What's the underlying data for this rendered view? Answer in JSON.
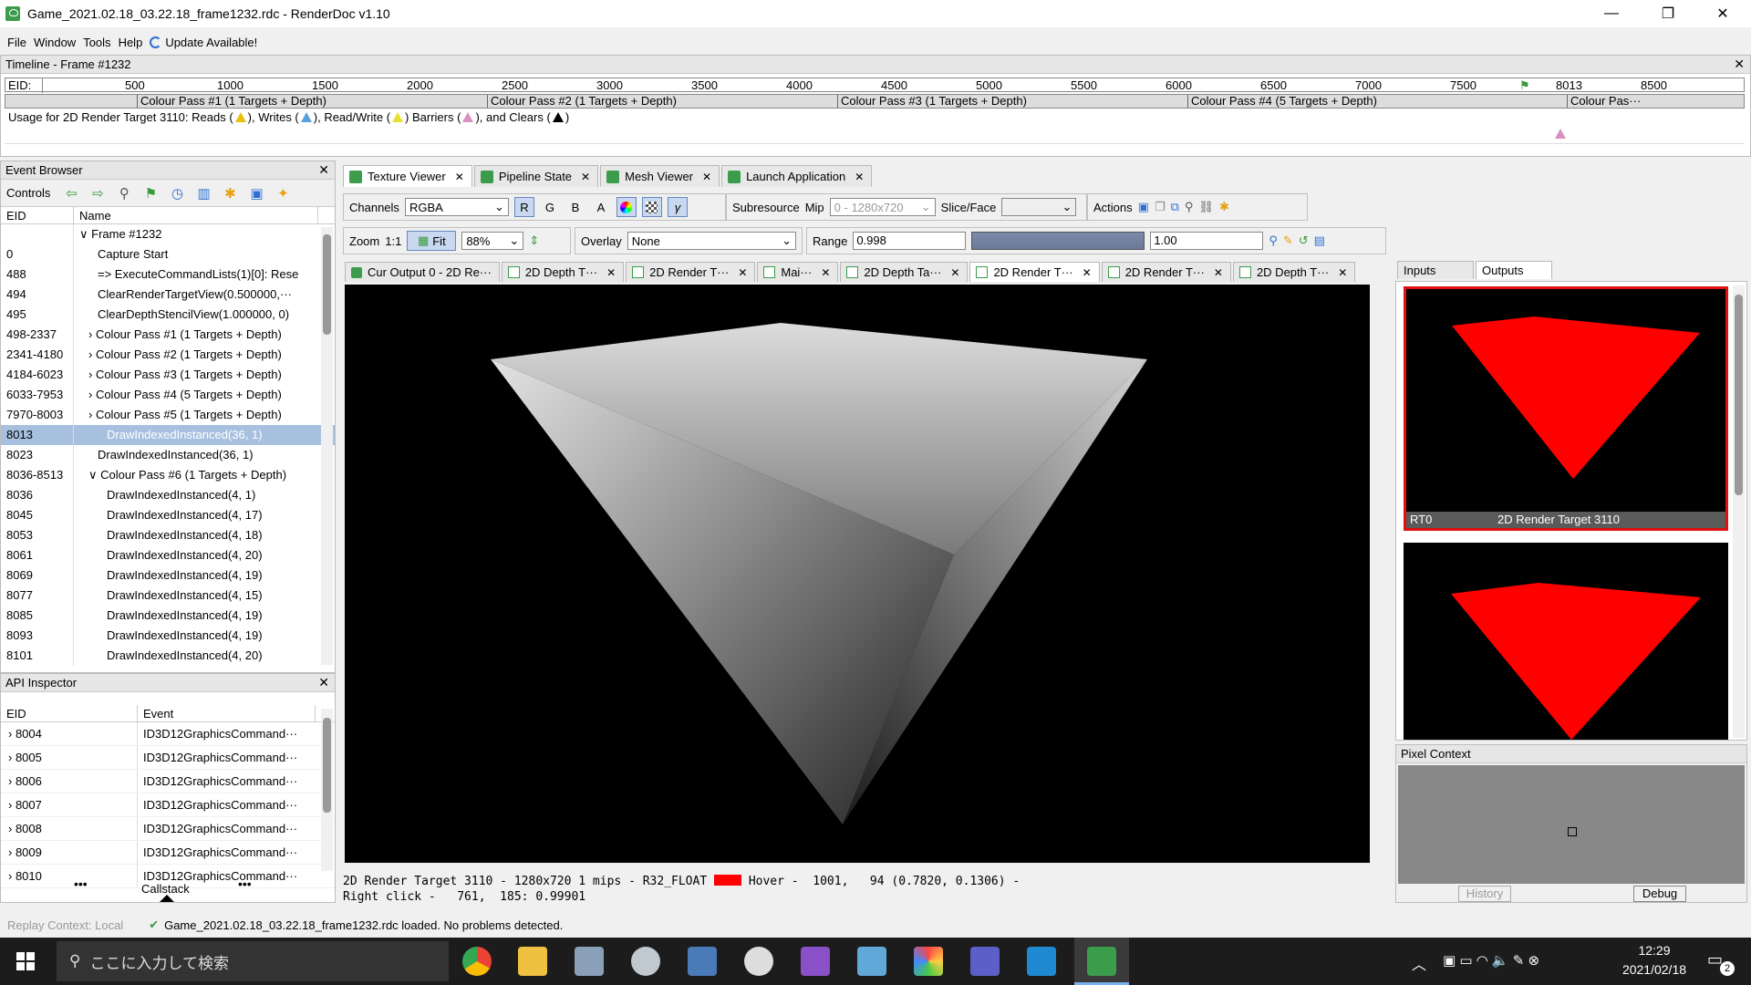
{
  "window": {
    "title": "Game_2021.02.18_03.22.18_frame1232.rdc - RenderDoc v1.10",
    "min": "—",
    "max": "❐",
    "close": "✕"
  },
  "menu": {
    "items": [
      "File",
      "Window",
      "Tools",
      "Help"
    ],
    "update": "Update Available!"
  },
  "timeline": {
    "title": "Timeline - Frame #1232",
    "eid_label": "EID:",
    "ticks": [
      "500",
      "1000",
      "1500",
      "2000",
      "2500",
      "3000",
      "3500",
      "4000",
      "4500",
      "5000",
      "5500",
      "6000",
      "6500",
      "7000",
      "7500",
      "8013",
      "8500"
    ],
    "passes": [
      "Colour Pass #1 (1 Targets + Depth)",
      "Colour Pass #2 (1 Targets + Depth)",
      "Colour Pass #3 (1 Targets + Depth)",
      "Colour Pass #4 (5 Targets + Depth)",
      "Colour Pas···"
    ],
    "usage": {
      "prefix": "Usage for 2D Render Target 3110: Reads (",
      "writes": "), Writes (",
      "readwrite": "), Read/Write (",
      "barriers": ") Barriers (",
      "clears": "), and Clears (",
      "end": ")"
    },
    "colors": {
      "reads": "#e8c010",
      "writes": "#5aa0e0",
      "readwrite": "#e8e030",
      "barriers": "#d890c0",
      "clears": "#000000"
    }
  },
  "event_browser": {
    "title": "Event Browser",
    "controls_label": "Controls",
    "cols": [
      "EID",
      "Name"
    ],
    "rows": [
      {
        "eid": "",
        "name": "∨ Frame #1232",
        "indent": 0
      },
      {
        "eid": "0",
        "name": "Capture Start",
        "indent": 2
      },
      {
        "eid": "488",
        "name": "=> ExecuteCommandLists(1)[0]: Rese",
        "indent": 2
      },
      {
        "eid": "494",
        "name": "ClearRenderTargetView(0.500000,···",
        "indent": 2
      },
      {
        "eid": "495",
        "name": "ClearDepthStencilView(1.000000, 0)",
        "indent": 2
      },
      {
        "eid": "498-2337",
        "name": "› Colour Pass #1 (1 Targets + Depth)",
        "indent": 1
      },
      {
        "eid": "2341-4180",
        "name": "› Colour Pass #2 (1 Targets + Depth)",
        "indent": 1
      },
      {
        "eid": "4184-6023",
        "name": "› Colour Pass #3 (1 Targets + Depth)",
        "indent": 1
      },
      {
        "eid": "6033-7953",
        "name": "› Colour Pass #4 (5 Targets + Depth)",
        "indent": 1
      },
      {
        "eid": "7970-8003",
        "name": "› Colour Pass #5 (1 Targets + Depth)",
        "indent": 1
      },
      {
        "eid": "8013",
        "name": "DrawIndexedInstanced(36, 1)",
        "indent": 3,
        "selected": true
      },
      {
        "eid": "8023",
        "name": "DrawIndexedInstanced(36, 1)",
        "indent": 2
      },
      {
        "eid": "8036-8513",
        "name": "∨ Colour Pass #6 (1 Targets + Depth)",
        "indent": 1
      },
      {
        "eid": "8036",
        "name": "DrawIndexedInstanced(4, 1)",
        "indent": 3
      },
      {
        "eid": "8045",
        "name": "DrawIndexedInstanced(4, 17)",
        "indent": 3
      },
      {
        "eid": "8053",
        "name": "DrawIndexedInstanced(4, 18)",
        "indent": 3
      },
      {
        "eid": "8061",
        "name": "DrawIndexedInstanced(4, 20)",
        "indent": 3
      },
      {
        "eid": "8069",
        "name": "DrawIndexedInstanced(4, 19)",
        "indent": 3
      },
      {
        "eid": "8077",
        "name": "DrawIndexedInstanced(4, 15)",
        "indent": 3
      },
      {
        "eid": "8085",
        "name": "DrawIndexedInstanced(4, 19)",
        "indent": 3
      },
      {
        "eid": "8093",
        "name": "DrawIndexedInstanced(4, 19)",
        "indent": 3
      },
      {
        "eid": "8101",
        "name": "DrawIndexedInstanced(4, 20)",
        "indent": 3
      }
    ]
  },
  "api_inspector": {
    "title": "API Inspector",
    "cols": [
      "EID",
      "Event"
    ],
    "rows": [
      {
        "eid": "8004",
        "event": "ID3D12GraphicsCommand···"
      },
      {
        "eid": "8005",
        "event": "ID3D12GraphicsCommand···"
      },
      {
        "eid": "8006",
        "event": "ID3D12GraphicsCommand···"
      },
      {
        "eid": "8007",
        "event": "ID3D12GraphicsCommand···"
      },
      {
        "eid": "8008",
        "event": "ID3D12GraphicsCommand···"
      },
      {
        "eid": "8009",
        "event": "ID3D12GraphicsCommand···"
      },
      {
        "eid": "8010",
        "event": "ID3D12GraphicsCommand···"
      }
    ],
    "callstack": "Callstack",
    "dots": "•••"
  },
  "main_tabs": [
    "Texture Viewer",
    "Pipeline State",
    "Mesh Viewer",
    "Launch Application"
  ],
  "toolbar": {
    "channels_label": "Channels",
    "channels_value": "RGBA",
    "r": "R",
    "g": "G",
    "b": "B",
    "a": "A",
    "gamma": "γ",
    "subresource": "Subresource",
    "mip_label": "Mip",
    "mip_value": "0 - 1280x720",
    "slice_label": "Slice/Face",
    "actions": "Actions",
    "zoom_label": "Zoom",
    "zoom_ratio": "1:1",
    "fit": "Fit",
    "zoom_value": "88%",
    "overlay_label": "Overlay",
    "overlay_value": "None",
    "range_label": "Range",
    "range_min": "0.998",
    "range_max": "1.00"
  },
  "tex_tabs": [
    "Cur Output 0 - 2D Re···",
    "2D Depth T···",
    "2D Render T···",
    "Mai···",
    "2D Depth Ta···",
    "2D Render T···",
    "2D Render T···",
    "2D Depth T···"
  ],
  "status_line1": "2D Render Target 3110 - 1280x720 1 mips - R32_FLOAT",
  "status_line1b": "Hover -  1001,   94 (0.7820, 0.1306) -",
  "status_line2": "Right click -   761,  185: 0.99901",
  "io": {
    "tabs": [
      "Inputs",
      "Outputs"
    ],
    "thumbs": [
      {
        "slot": "RT0",
        "name": "2D Render Target 3110"
      },
      {
        "slot": "",
        "name": ""
      }
    ]
  },
  "pixel_context": {
    "title": "Pixel Context",
    "history": "History",
    "debug": "Debug"
  },
  "statusbar": {
    "replay": "Replay Context: Local",
    "loaded": "Game_2021.02.18_03.22.18_frame1232.rdc loaded. No problems detected."
  },
  "taskbar": {
    "search": "ここに入力して検索",
    "time": "12:29",
    "date": "2021/02/18",
    "notif": "2"
  }
}
